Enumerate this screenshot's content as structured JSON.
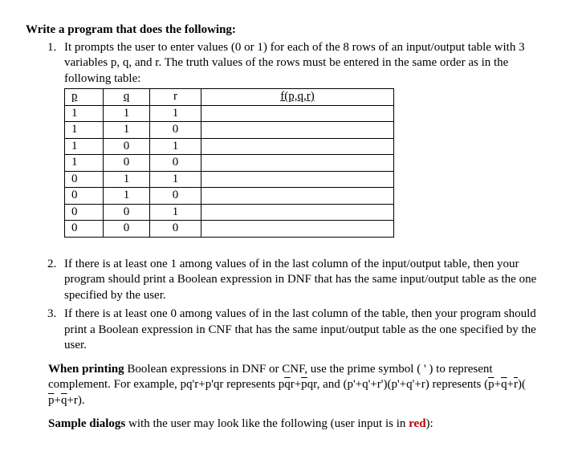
{
  "heading": "Write a program that does the following:",
  "item1_text": "It prompts the user to enter values (0 or 1) for each of the 8 rows of an input/output table with 3 variables p, q, and r. The truth values of the rows must be entered in the same order as in the following table:",
  "table": {
    "headers": {
      "p": "p",
      "q": "q",
      "r": "r",
      "f": "f(p,q,r)"
    },
    "rows": [
      {
        "p": "1",
        "q": "1",
        "r": "1"
      },
      {
        "p": "1",
        "q": "1",
        "r": "0"
      },
      {
        "p": "1",
        "q": "0",
        "r": "1"
      },
      {
        "p": "1",
        "q": "0",
        "r": "0"
      },
      {
        "p": "0",
        "q": "1",
        "r": "1"
      },
      {
        "p": "0",
        "q": "1",
        "r": "0"
      },
      {
        "p": "0",
        "q": "0",
        "r": "1"
      },
      {
        "p": "0",
        "q": "0",
        "r": "0"
      }
    ]
  },
  "item2_text": "If there is at least one 1 among values of in the last column of the input/output table, then your program should print a Boolean expression in DNF that has the same input/output table as the one specified by the user.",
  "item3_text": "If there is at least one 0 among values of in the last column of the table, then your program should print a Boolean expression in CNF that has the same input/output table as the one specified by the user.",
  "printing_para": {
    "lead_bold": "When printing",
    "body1": " Boolean expressions in DNF or CNF, use the prime symbol ( ' ) to represent complement. For example, pq'r+p'qr represents p",
    "q1": "q",
    "body2": "r+",
    "p1": "p",
    "body3": "qr, and (p'+q'+r')(p'+q'+r) represents (",
    "p2": "p",
    "plus1": "+",
    "q2": "q",
    "plus2": "+",
    "r1": "r",
    "body4": ")( ",
    "p3": "p",
    "plus3": "+",
    "q3": "q",
    "body5": "+r)."
  },
  "sample_para": {
    "lead_bold": "Sample dialogs",
    "body": " with the user may look like the following (user input is in ",
    "red": "red",
    "tail": "):"
  }
}
